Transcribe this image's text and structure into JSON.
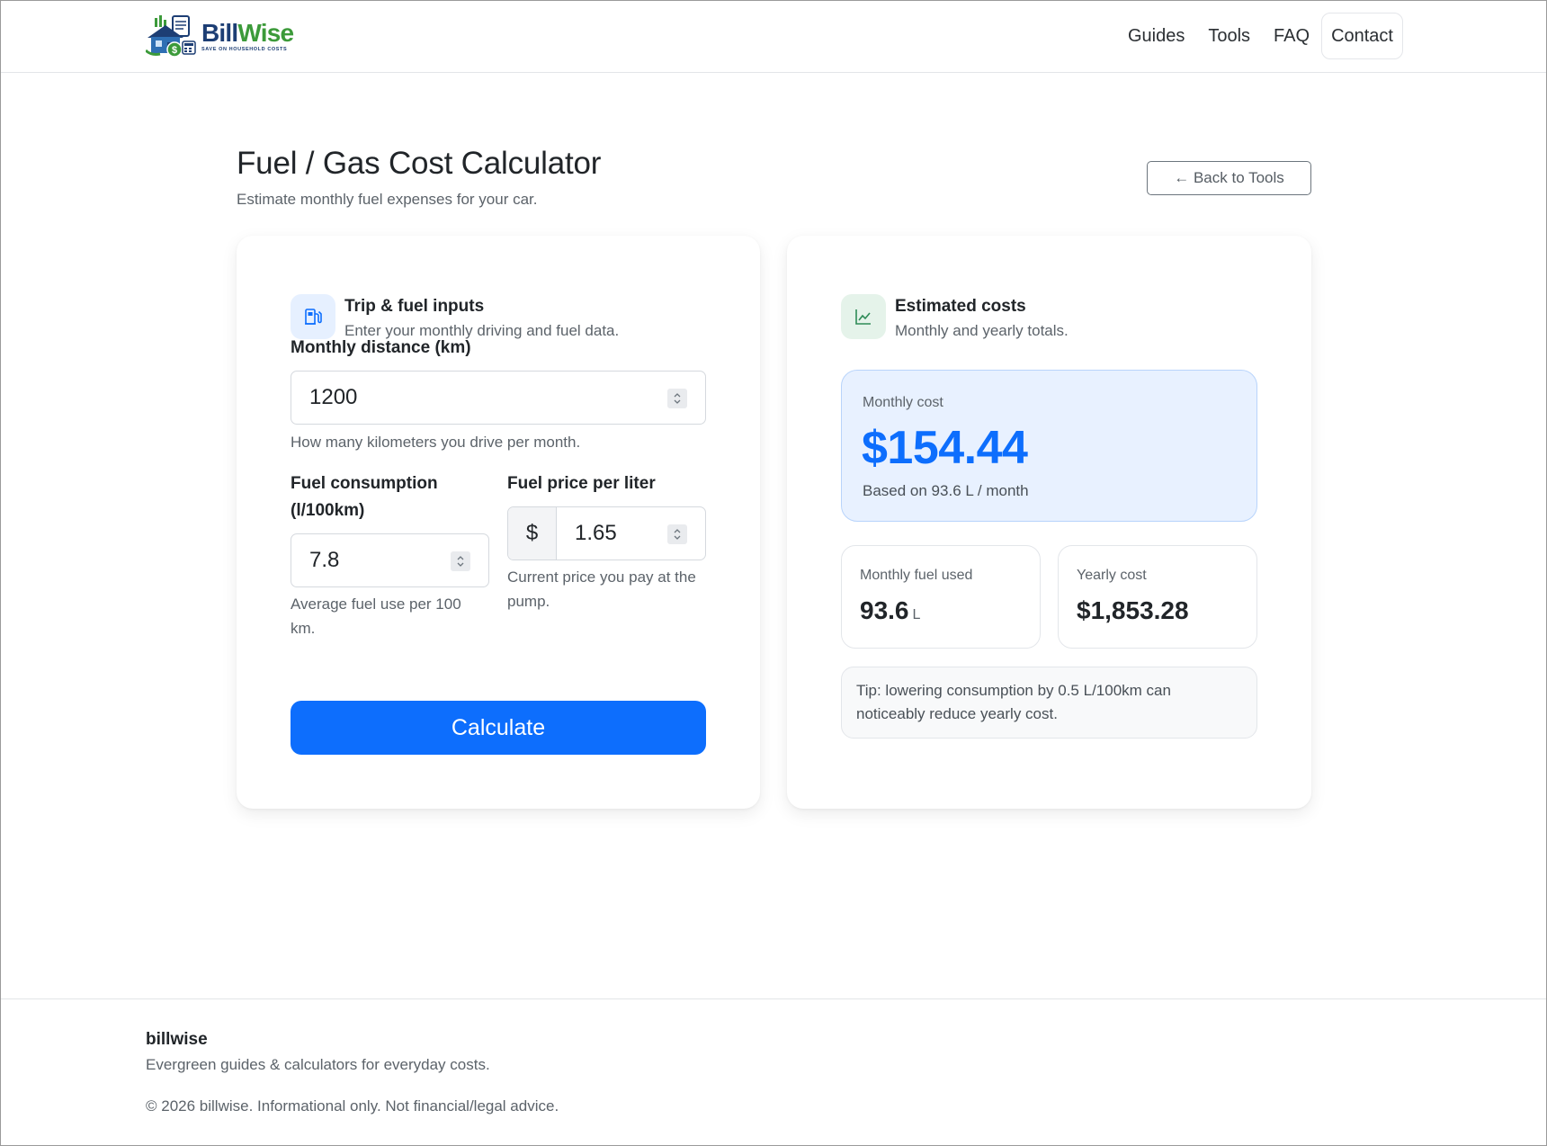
{
  "header": {
    "brand": {
      "name_part1": "Bill",
      "name_part2": "Wise",
      "tagline": "SAVE ON HOUSEHOLD COSTS"
    },
    "nav": [
      {
        "label": "Guides"
      },
      {
        "label": "Tools"
      },
      {
        "label": "FAQ"
      },
      {
        "label": "Contact",
        "active": true
      }
    ]
  },
  "page": {
    "title": "Fuel / Gas Cost Calculator",
    "subtitle": "Estimate monthly fuel expenses for your car.",
    "back_label": "← Back to Tools"
  },
  "inputs_card": {
    "icon": "fuel-pump-icon",
    "title": "Trip & fuel inputs",
    "subtitle": "Enter your monthly driving and fuel data.",
    "distance": {
      "label": "Monthly distance (km)",
      "value": "1200",
      "help": "How many kilometers you drive per month."
    },
    "consumption": {
      "label_line1": "Fuel consumption",
      "label_line2": "(l/100km)",
      "value": "7.8",
      "help_line1": "Average fuel use per 100",
      "help_line2": "km."
    },
    "price": {
      "label": "Fuel price per liter",
      "currency": "$",
      "value": "1.65",
      "help_line1": "Current price you pay at the",
      "help_line2": "pump."
    },
    "calculate_label": "Calculate"
  },
  "results_card": {
    "icon": "line-chart-icon",
    "title": "Estimated costs",
    "subtitle": "Monthly and yearly totals.",
    "monthly": {
      "label": "Monthly cost",
      "value": "$154.44",
      "note": "Based on 93.6 L / month"
    },
    "fuel_used": {
      "label": "Monthly fuel used",
      "value": "93.6",
      "unit": "L"
    },
    "yearly": {
      "label": "Yearly cost",
      "value": "$1,853.28"
    },
    "tip_line1": "Tip: lowering consumption by 0.5 L/100km can",
    "tip_line2": "noticeably reduce yearly cost."
  },
  "footer": {
    "name": "billwise",
    "tagline": "Evergreen guides & calculators for everyday costs.",
    "copyright": "© 2026 billwise. Informational only. Not financial/legal advice."
  },
  "colors": {
    "primary": "#0d6efd",
    "brand_dark": "#1d3e74",
    "brand_green": "#3c9a3a",
    "result_bg": "#e8f1ff"
  }
}
